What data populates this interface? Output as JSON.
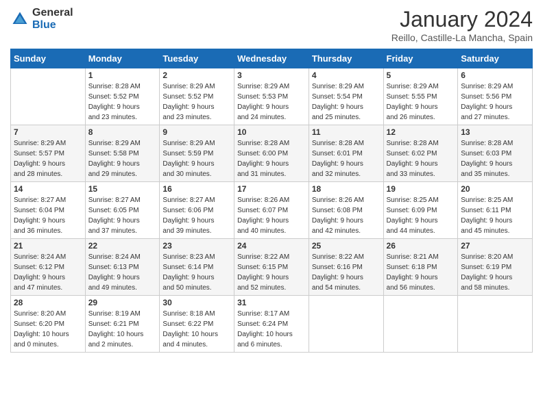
{
  "header": {
    "logo": {
      "line1": "General",
      "line2": "Blue"
    },
    "title": "January 2024",
    "location": "Reillo, Castille-La Mancha, Spain"
  },
  "days_of_week": [
    "Sunday",
    "Monday",
    "Tuesday",
    "Wednesday",
    "Thursday",
    "Friday",
    "Saturday"
  ],
  "weeks": [
    [
      {
        "day": "",
        "info": ""
      },
      {
        "day": "1",
        "info": "Sunrise: 8:28 AM\nSunset: 5:52 PM\nDaylight: 9 hours\nand 23 minutes."
      },
      {
        "day": "2",
        "info": "Sunrise: 8:29 AM\nSunset: 5:52 PM\nDaylight: 9 hours\nand 23 minutes."
      },
      {
        "day": "3",
        "info": "Sunrise: 8:29 AM\nSunset: 5:53 PM\nDaylight: 9 hours\nand 24 minutes."
      },
      {
        "day": "4",
        "info": "Sunrise: 8:29 AM\nSunset: 5:54 PM\nDaylight: 9 hours\nand 25 minutes."
      },
      {
        "day": "5",
        "info": "Sunrise: 8:29 AM\nSunset: 5:55 PM\nDaylight: 9 hours\nand 26 minutes."
      },
      {
        "day": "6",
        "info": "Sunrise: 8:29 AM\nSunset: 5:56 PM\nDaylight: 9 hours\nand 27 minutes."
      }
    ],
    [
      {
        "day": "7",
        "info": "Sunrise: 8:29 AM\nSunset: 5:57 PM\nDaylight: 9 hours\nand 28 minutes."
      },
      {
        "day": "8",
        "info": "Sunrise: 8:29 AM\nSunset: 5:58 PM\nDaylight: 9 hours\nand 29 minutes."
      },
      {
        "day": "9",
        "info": "Sunrise: 8:29 AM\nSunset: 5:59 PM\nDaylight: 9 hours\nand 30 minutes."
      },
      {
        "day": "10",
        "info": "Sunrise: 8:28 AM\nSunset: 6:00 PM\nDaylight: 9 hours\nand 31 minutes."
      },
      {
        "day": "11",
        "info": "Sunrise: 8:28 AM\nSunset: 6:01 PM\nDaylight: 9 hours\nand 32 minutes."
      },
      {
        "day": "12",
        "info": "Sunrise: 8:28 AM\nSunset: 6:02 PM\nDaylight: 9 hours\nand 33 minutes."
      },
      {
        "day": "13",
        "info": "Sunrise: 8:28 AM\nSunset: 6:03 PM\nDaylight: 9 hours\nand 35 minutes."
      }
    ],
    [
      {
        "day": "14",
        "info": "Sunrise: 8:27 AM\nSunset: 6:04 PM\nDaylight: 9 hours\nand 36 minutes."
      },
      {
        "day": "15",
        "info": "Sunrise: 8:27 AM\nSunset: 6:05 PM\nDaylight: 9 hours\nand 37 minutes."
      },
      {
        "day": "16",
        "info": "Sunrise: 8:27 AM\nSunset: 6:06 PM\nDaylight: 9 hours\nand 39 minutes."
      },
      {
        "day": "17",
        "info": "Sunrise: 8:26 AM\nSunset: 6:07 PM\nDaylight: 9 hours\nand 40 minutes."
      },
      {
        "day": "18",
        "info": "Sunrise: 8:26 AM\nSunset: 6:08 PM\nDaylight: 9 hours\nand 42 minutes."
      },
      {
        "day": "19",
        "info": "Sunrise: 8:25 AM\nSunset: 6:09 PM\nDaylight: 9 hours\nand 44 minutes."
      },
      {
        "day": "20",
        "info": "Sunrise: 8:25 AM\nSunset: 6:11 PM\nDaylight: 9 hours\nand 45 minutes."
      }
    ],
    [
      {
        "day": "21",
        "info": "Sunrise: 8:24 AM\nSunset: 6:12 PM\nDaylight: 9 hours\nand 47 minutes."
      },
      {
        "day": "22",
        "info": "Sunrise: 8:24 AM\nSunset: 6:13 PM\nDaylight: 9 hours\nand 49 minutes."
      },
      {
        "day": "23",
        "info": "Sunrise: 8:23 AM\nSunset: 6:14 PM\nDaylight: 9 hours\nand 50 minutes."
      },
      {
        "day": "24",
        "info": "Sunrise: 8:22 AM\nSunset: 6:15 PM\nDaylight: 9 hours\nand 52 minutes."
      },
      {
        "day": "25",
        "info": "Sunrise: 8:22 AM\nSunset: 6:16 PM\nDaylight: 9 hours\nand 54 minutes."
      },
      {
        "day": "26",
        "info": "Sunrise: 8:21 AM\nSunset: 6:18 PM\nDaylight: 9 hours\nand 56 minutes."
      },
      {
        "day": "27",
        "info": "Sunrise: 8:20 AM\nSunset: 6:19 PM\nDaylight: 9 hours\nand 58 minutes."
      }
    ],
    [
      {
        "day": "28",
        "info": "Sunrise: 8:20 AM\nSunset: 6:20 PM\nDaylight: 10 hours\nand 0 minutes."
      },
      {
        "day": "29",
        "info": "Sunrise: 8:19 AM\nSunset: 6:21 PM\nDaylight: 10 hours\nand 2 minutes."
      },
      {
        "day": "30",
        "info": "Sunrise: 8:18 AM\nSunset: 6:22 PM\nDaylight: 10 hours\nand 4 minutes."
      },
      {
        "day": "31",
        "info": "Sunrise: 8:17 AM\nSunset: 6:24 PM\nDaylight: 10 hours\nand 6 minutes."
      },
      {
        "day": "",
        "info": ""
      },
      {
        "day": "",
        "info": ""
      },
      {
        "day": "",
        "info": ""
      }
    ]
  ]
}
